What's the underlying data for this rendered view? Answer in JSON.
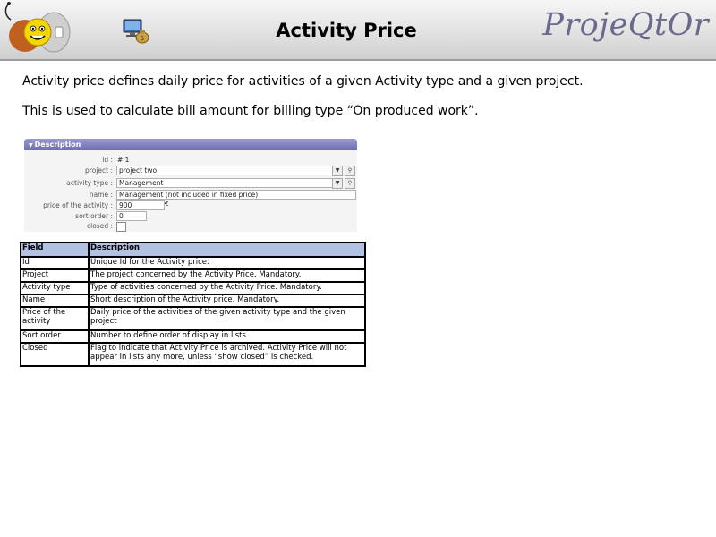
{
  "header": {
    "title": "Activity Price",
    "brand": "ProjeQtOr",
    "logo_icon": "smiley-logo-icon",
    "section_icon": "money-bag-monitor-icon"
  },
  "intro": {
    "line1": "Activity price defines daily price for activities of a given Activity type and a given project.",
    "line2": "This is used to calculate bill amount for billing type “On produced work”."
  },
  "form": {
    "section_title": "Description",
    "fields": {
      "id": {
        "label": "id :",
        "value": "# 1"
      },
      "project": {
        "label": "project :",
        "value": "project two"
      },
      "type": {
        "label": "activity type :",
        "value": "Management"
      },
      "name": {
        "label": "name :",
        "value": "Management (not included in fixed price)"
      },
      "price": {
        "label": "price of the activity :",
        "value": "900",
        "unit": "€"
      },
      "sort": {
        "label": "sort order :",
        "value": "0"
      },
      "closed": {
        "label": "closed :",
        "value": ""
      }
    }
  },
  "table": {
    "headers": [
      "Field",
      "Description"
    ],
    "rows": [
      {
        "field": "Id",
        "description": "Unique Id for the Activity price."
      },
      {
        "field": "Project",
        "description": "The project concerned by the Activity Price. Mandatory."
      },
      {
        "field": "Activity type",
        "description": "Type of activities concerned by the Activity Price. Mandatory."
      },
      {
        "field": "Name",
        "description": "Short description of the Activity price. Mandatory."
      },
      {
        "field": "Price of the activity",
        "description": "Daily price of the activities of the given activity type and the given project"
      },
      {
        "field": "Sort order",
        "description": "Number to define order of display in lists"
      },
      {
        "field": "Closed",
        "description": "Flag to indicate that Activity Price is archived. Activity Price will not appear in lists any more, unless “show closed” is checked."
      }
    ]
  }
}
